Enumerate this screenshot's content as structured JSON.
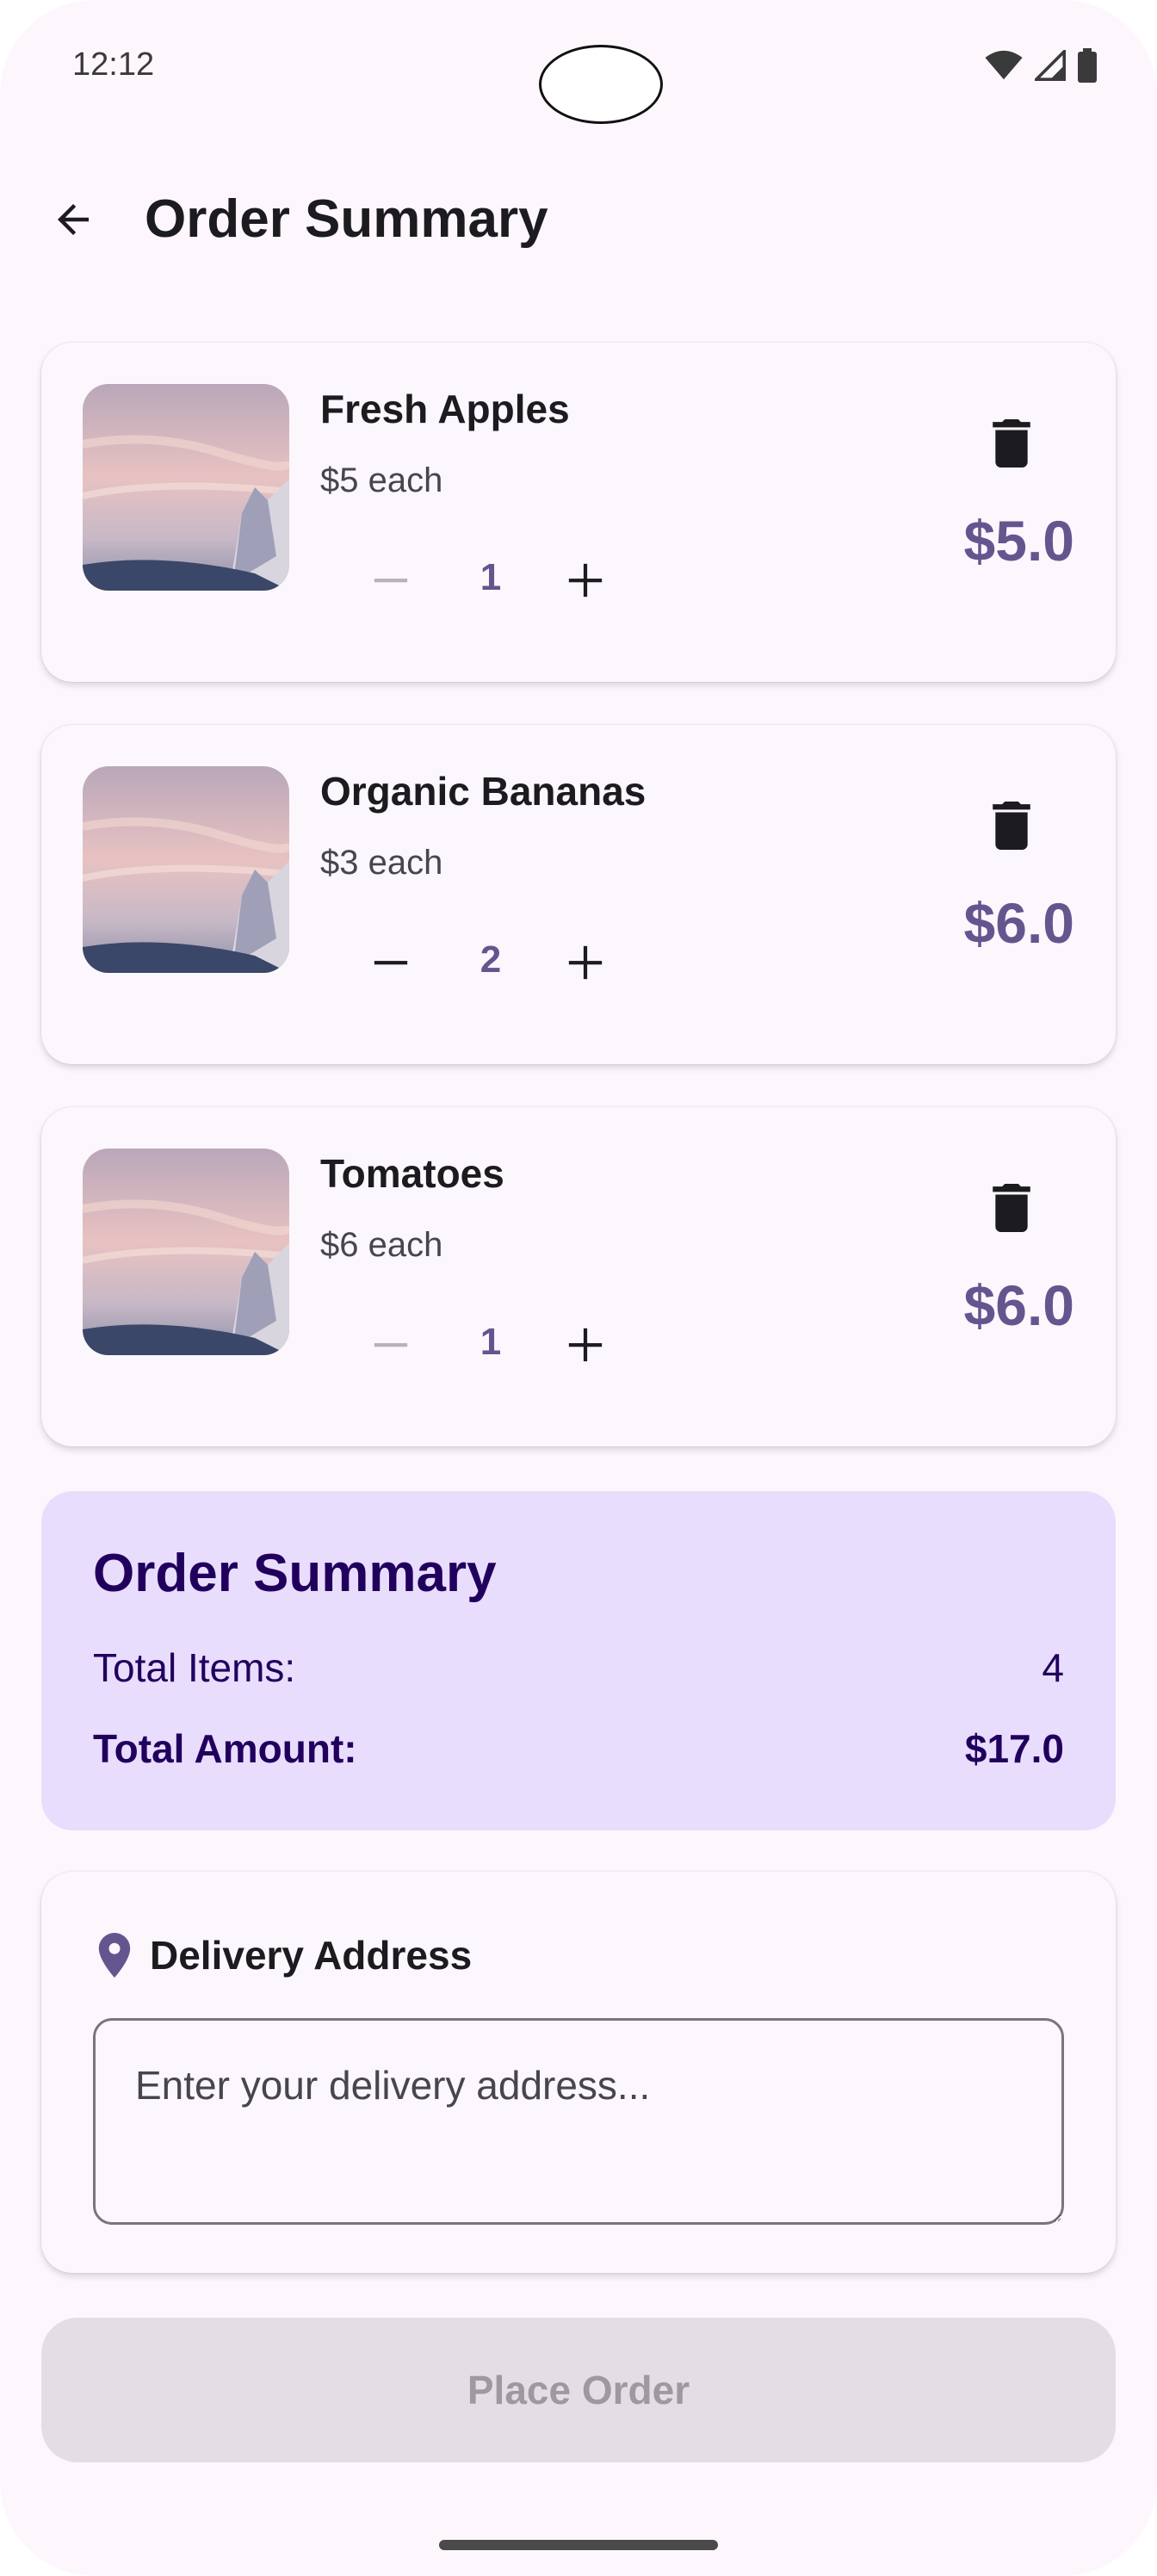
{
  "status_bar": {
    "time": "12:12"
  },
  "header": {
    "title": "Order Summary",
    "back_icon": "arrow-back-icon"
  },
  "items": [
    {
      "name": "Fresh Apples",
      "unit_price": "$5 each",
      "quantity": "1",
      "total": "$5.0",
      "minus_enabled": false
    },
    {
      "name": "Organic Bananas",
      "unit_price": "$3 each",
      "quantity": "2",
      "total": "$6.0",
      "minus_enabled": true
    },
    {
      "name": "Tomatoes",
      "unit_price": "$6 each",
      "quantity": "1",
      "total": "$6.0",
      "minus_enabled": false
    }
  ],
  "summary": {
    "title": "Order Summary",
    "items_label": "Total Items:",
    "items_value": "4",
    "amount_label": "Total Amount:",
    "amount_value": "$17.0"
  },
  "delivery": {
    "label": "Delivery Address",
    "icon": "location-pin-icon",
    "placeholder": "Enter your delivery address...",
    "value": ""
  },
  "place_order": {
    "label": "Place Order",
    "enabled": false
  },
  "colors": {
    "accent": "#65558f",
    "summary_bg": "#e9ddfd",
    "summary_text": "#21005d",
    "disabled_button_bg": "#e3dde4"
  }
}
